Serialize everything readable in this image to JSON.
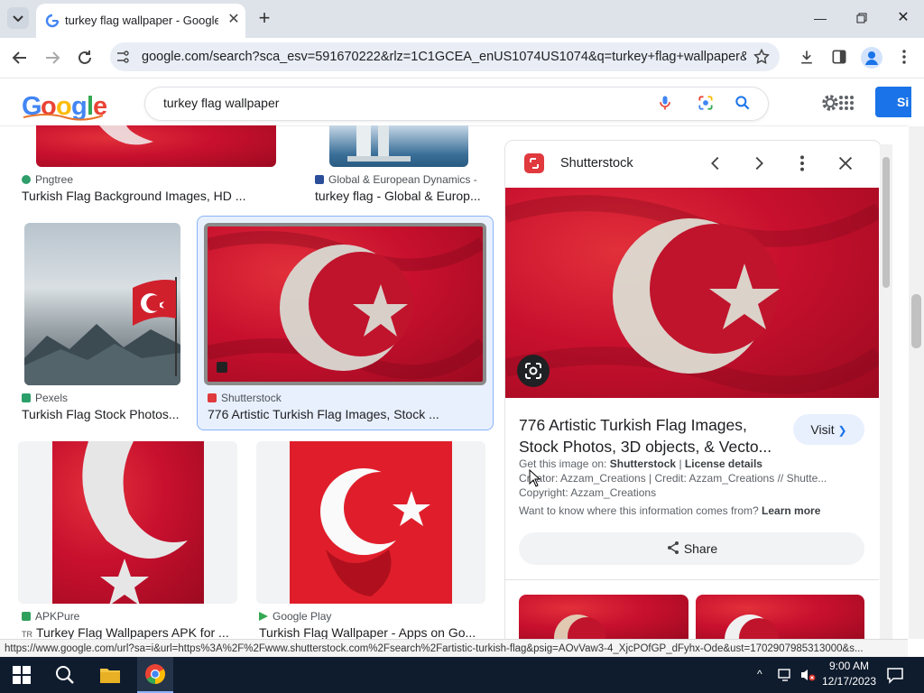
{
  "browser": {
    "tab_title": "turkey flag wallpaper - Google",
    "url": "google.com/search?sca_esv=591670222&rlz=1C1GCEA_enUS1074US1074&q=turkey+flag+wallpaper&tb...",
    "status_url": "https://www.google.com/url?sa=i&url=https%3A%2F%2Fwww.shutterstock.com%2Fsearch%2Fartistic-turkish-flag&psig=AOvVaw3-4_XjcPOfGP_dFyhx-Ode&ust=1702907985313000&s..."
  },
  "search": {
    "query": "turkey flag wallpaper",
    "signin_label": "Si"
  },
  "results": [
    {
      "source": "Pngtree",
      "title": "Turkish Flag Background Images, HD ...",
      "color": "#2e9e6a"
    },
    {
      "source": "Global & European Dynamics -",
      "title": "turkey flag - Global & Europ...",
      "color": "#2b4e9a"
    },
    {
      "source": "Pexels",
      "title": "Turkish Flag Stock Photos...",
      "color": "#2b9e6a"
    },
    {
      "source": "Shutterstock",
      "title": "776 Artistic Turkish Flag Images, Stock ...",
      "color": "#e0393e"
    },
    {
      "source": "APKPure",
      "title": "Turkey Flag Wallpapers APK for ...",
      "color": "#2ea05c"
    },
    {
      "source": "Google Play",
      "title": "Turkish Flag Wallpaper - Apps on Go...",
      "color": "#34a853"
    }
  ],
  "apk_prefix": "TR",
  "panel": {
    "site": "Shutterstock",
    "title": "776 Artistic Turkish Flag Images, Stock Photos, 3D objects, & Vecto...",
    "visit_label": "Visit",
    "get_image_prefix": "Get this image on:",
    "get_image_site": "Shutterstock",
    "separator": "|",
    "license_label": "License details",
    "creator": "Creator: Azzam_Creations | Credit: Azzam_Creations // Shutte...",
    "copyright": "Copyright: Azzam_Creations",
    "info_question": "Want to know where this information comes from?",
    "learn_more": "Learn more",
    "share_label": "Share"
  },
  "taskbar": {
    "time": "9:00 AM",
    "date": "12/17/2023"
  },
  "colors": {
    "accent": "#1a73e8",
    "flag_red": "#c8102e",
    "selected_border": "#8ab4f8",
    "taskbar": "#0f1c2e"
  }
}
